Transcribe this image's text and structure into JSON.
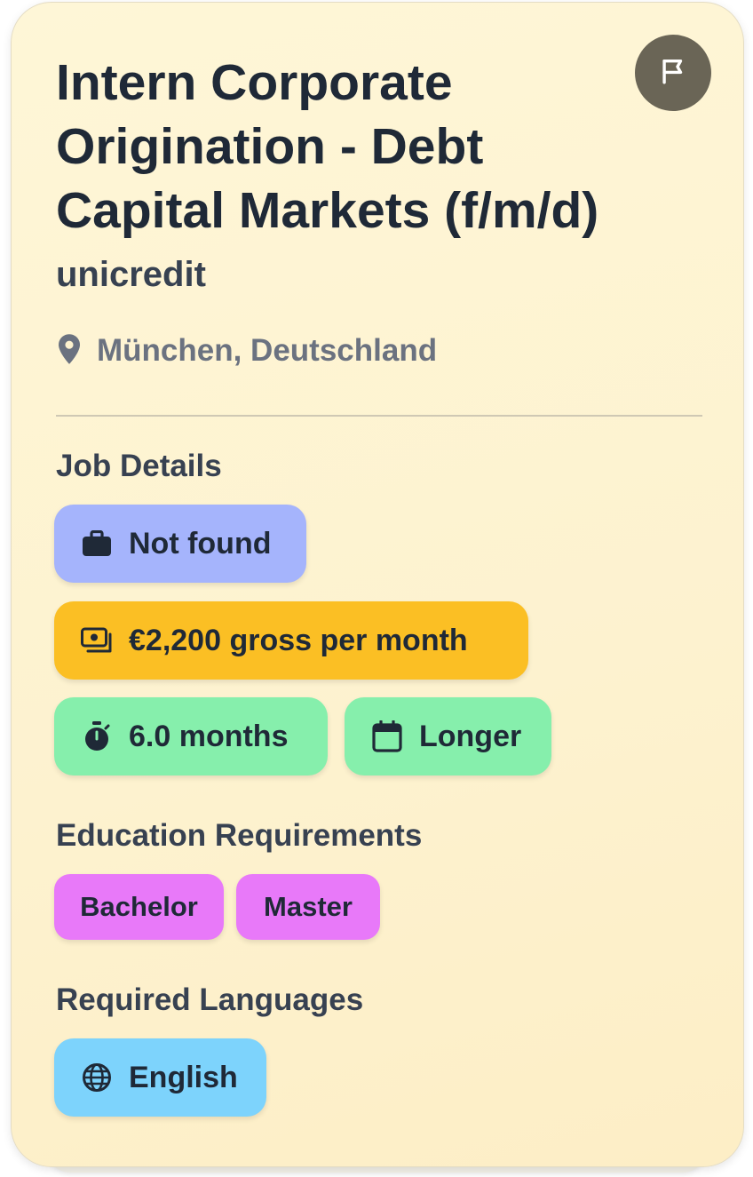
{
  "job": {
    "title": "Intern Corporate Origination - Debt Capital Markets (f/m/d)",
    "company": "unicredit",
    "location": "München, Deutschland"
  },
  "sections": {
    "job_details": "Job Details",
    "education": "Education Requirements",
    "languages": "Required Languages"
  },
  "details": {
    "work_type": "Not found",
    "salary": "€2,200 gross per month",
    "duration": "6.0 months",
    "start": "Longer"
  },
  "education": [
    "Bachelor",
    "Master"
  ],
  "languages": [
    "English"
  ],
  "colors": {
    "work_type_chip": "#a5b4fc",
    "salary_chip": "#fbbf24",
    "duration_chip": "#86efac",
    "education_chip": "#e879f9",
    "language_chip": "#7dd3fc",
    "flag_button": "#6a6556"
  },
  "icons": {
    "flag": "flag-icon",
    "location": "map-pin-icon",
    "work_type": "briefcase-icon",
    "salary": "money-icon",
    "duration": "stopwatch-icon",
    "start": "calendar-icon",
    "language": "globe-icon"
  }
}
